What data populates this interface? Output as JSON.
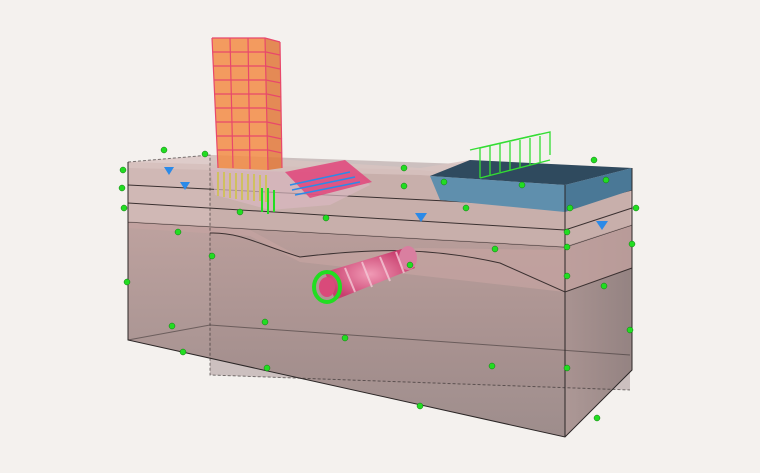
{
  "scene": {
    "kind": "3D geotechnical model viewport",
    "objects": [
      "soil-block",
      "soil-layers",
      "high-rise-building",
      "excavation-retaining-wall",
      "tunnel",
      "water-basin",
      "surface-load",
      "boundary-fixities",
      "water-level-markers"
    ],
    "colors": {
      "background": "#f4f1ee",
      "soil_top": "#c9a8a2",
      "soil_mid": "#b89592",
      "soil_deep": "#9a8887",
      "building": "#f08a3e",
      "building_frame": "#e8486b",
      "tunnel": "#d94a7a",
      "water": "#4f7f9c",
      "fixity": "#22dd22",
      "water_marker": "#2b8ae8",
      "load": "#33dd33"
    }
  }
}
